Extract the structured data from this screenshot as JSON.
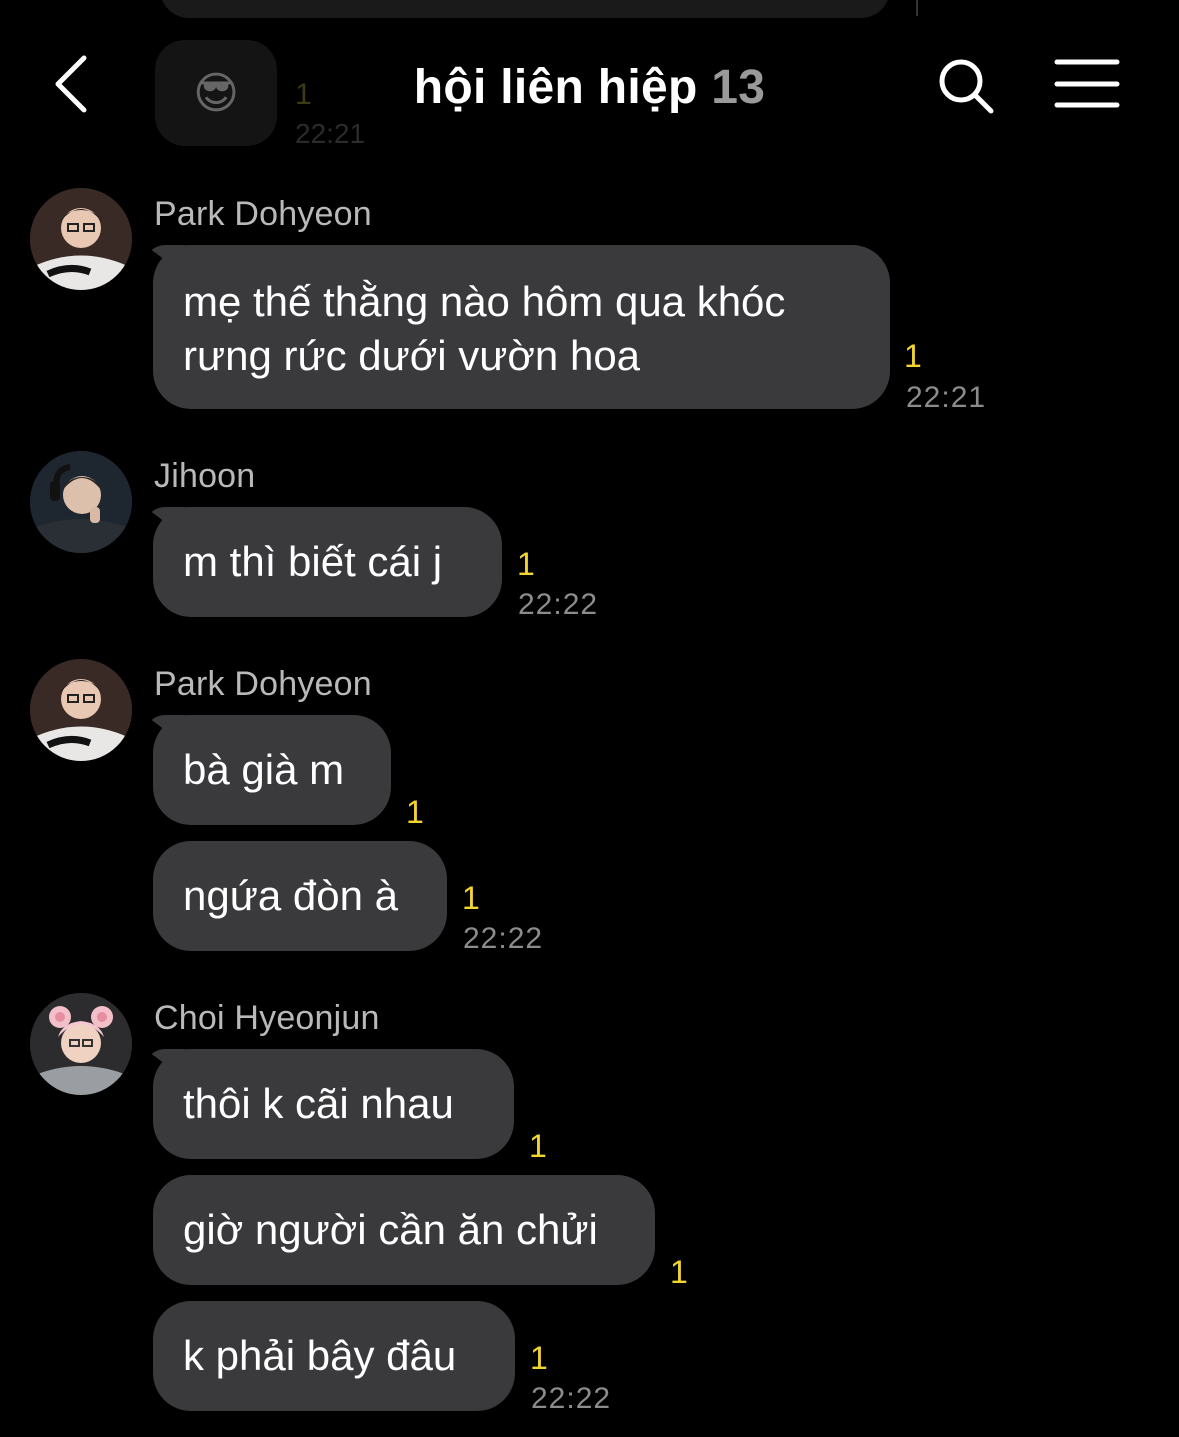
{
  "header": {
    "title": "hội liên hiệp",
    "member_count": "13",
    "back_icon": "chevron-left-icon",
    "search_icon": "search-icon",
    "menu_icon": "hamburger-menu-icon"
  },
  "faded_previous": {
    "emoji": "😎",
    "unread": "1",
    "time": "22:21"
  },
  "messages": [
    {
      "sender": "Park Dohyeon",
      "bubbles": [
        {
          "lines": [
            "mẹ thế thằng nào hôm qua khóc",
            "rưng rức dưới vườn hoa"
          ],
          "unread": "1",
          "time": "22:21"
        }
      ]
    },
    {
      "sender": "Jihoon",
      "bubbles": [
        {
          "text": "m thì biết cái j",
          "unread": "1",
          "time": "22:22"
        }
      ]
    },
    {
      "sender": "Park Dohyeon",
      "bubbles": [
        {
          "text": "bà già m",
          "unread": "1"
        },
        {
          "text": "ngứa đòn à",
          "unread": "1",
          "time": "22:22"
        }
      ]
    },
    {
      "sender": "Choi Hyeonjun",
      "bubbles": [
        {
          "text": "thôi k cãi nhau",
          "unread": "1"
        },
        {
          "text": "giờ người cần ăn chửi",
          "unread": "1"
        },
        {
          "text": "k phải bây đâu",
          "unread": "1",
          "time": "22:22"
        }
      ]
    }
  ],
  "colors": {
    "background": "#000000",
    "bubble": "#3a3a3c",
    "unread": "#f2d530",
    "time": "#8c8c8c"
  }
}
